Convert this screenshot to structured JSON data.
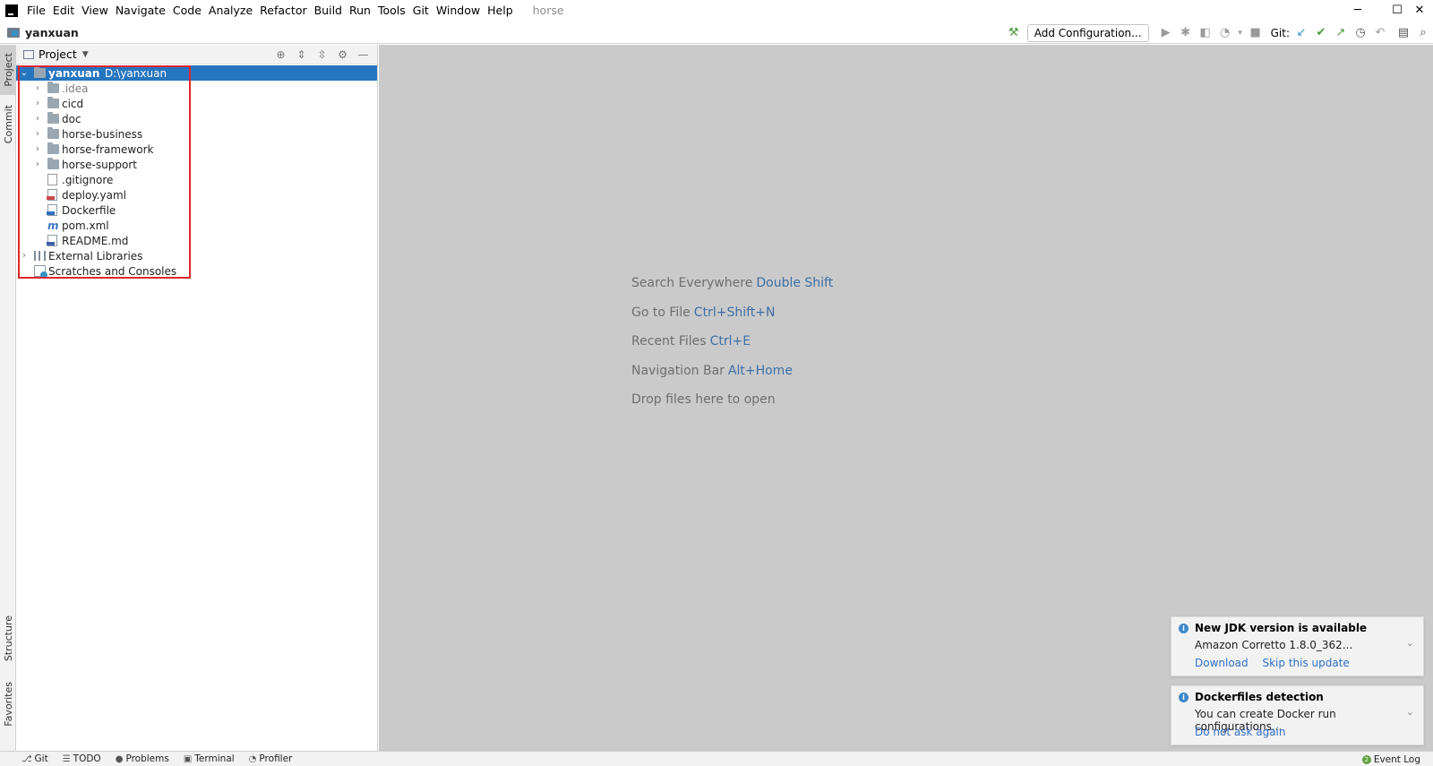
{
  "menubar": {
    "items": [
      "File",
      "Edit",
      "View",
      "Navigate",
      "Code",
      "Analyze",
      "Refactor",
      "Build",
      "Run",
      "Tools",
      "Git",
      "Window",
      "Help"
    ],
    "project_title": "horse",
    "controls": {
      "minimize": "─",
      "maximize": "☐",
      "close": "✕"
    }
  },
  "navbar": {
    "breadcrumb": "yanxuan",
    "add_config_label": "Add Configuration...",
    "git_label": "Git:"
  },
  "left_stripe": {
    "tabs": [
      "Project",
      "Commit",
      "Structure",
      "Favorites"
    ]
  },
  "project_panel": {
    "title": "Project",
    "tree": [
      {
        "label": "yanxuan",
        "sub": "D:\\yanxuan",
        "type": "module",
        "depth": 0,
        "expanded": true,
        "selected": true
      },
      {
        "label": ".idea",
        "type": "folder",
        "depth": 1,
        "muted": true
      },
      {
        "label": "cicd",
        "type": "folder",
        "depth": 1
      },
      {
        "label": "doc",
        "type": "folder",
        "depth": 1
      },
      {
        "label": "horse-business",
        "type": "folder",
        "depth": 1
      },
      {
        "label": "horse-framework",
        "type": "folder",
        "depth": 1
      },
      {
        "label": "horse-support",
        "type": "folder",
        "depth": 1
      },
      {
        "label": ".gitignore",
        "type": "git-file",
        "depth": 1
      },
      {
        "label": "deploy.yaml",
        "type": "yaml-file",
        "depth": 1
      },
      {
        "label": "Dockerfile",
        "type": "docker-file",
        "depth": 1
      },
      {
        "label": "pom.xml",
        "type": "maven-file",
        "depth": 1
      },
      {
        "label": "README.md",
        "type": "md-file",
        "depth": 1
      },
      {
        "label": "External Libraries",
        "type": "libraries",
        "depth": 0
      },
      {
        "label": "Scratches and Consoles",
        "type": "scratches",
        "depth": 0
      }
    ]
  },
  "editor": {
    "hints": [
      {
        "text": "Search Everywhere",
        "key": "Double Shift"
      },
      {
        "text": "Go to File",
        "key": "Ctrl+Shift+N"
      },
      {
        "text": "Recent Files",
        "key": "Ctrl+E"
      },
      {
        "text": "Navigation Bar",
        "key": "Alt+Home"
      },
      {
        "text": "Drop files here to open",
        "key": ""
      }
    ]
  },
  "notifications": [
    {
      "title": "New JDK version is available",
      "body": "Amazon Corretto 1.8.0_362...",
      "links": [
        "Download",
        "Skip this update"
      ]
    },
    {
      "title": "Dockerfiles detection",
      "body": "You can create Docker run configurations...",
      "links": [
        "Do not ask again"
      ]
    }
  ],
  "statusbar": {
    "tabs": [
      "Git",
      "TODO",
      "Problems",
      "Terminal",
      "Profiler"
    ],
    "event_log": "Event Log"
  },
  "colors": {
    "selection": "#2675bf",
    "highlight_box": "#e0262c",
    "link": "#2f6fc4",
    "editor_bg": "#cacaca"
  }
}
